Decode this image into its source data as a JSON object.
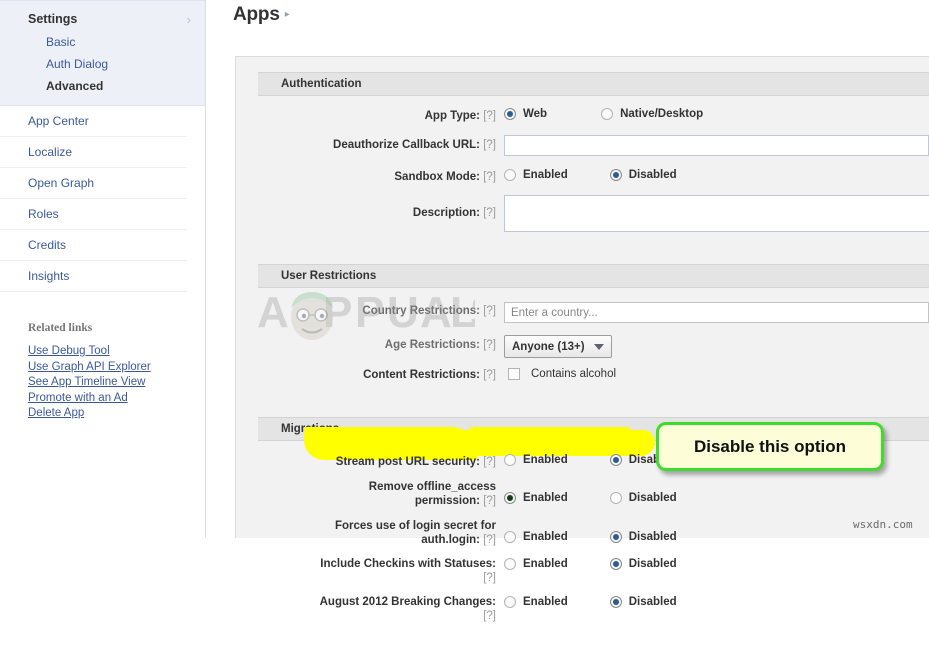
{
  "sidebar": {
    "settings": {
      "title": "Settings",
      "chevron_icon": "chevron-right-icon",
      "items": [
        {
          "label": "Basic",
          "current": false
        },
        {
          "label": "Auth Dialog",
          "current": false
        },
        {
          "label": "Advanced",
          "current": true
        }
      ]
    },
    "nav_items": [
      {
        "label": "App Center"
      },
      {
        "label": "Localize"
      },
      {
        "label": "Open Graph"
      },
      {
        "label": "Roles"
      },
      {
        "label": "Credits"
      },
      {
        "label": "Insights"
      }
    ],
    "related": {
      "title": "Related links",
      "links": [
        {
          "label": "Use Debug Tool"
        },
        {
          "label": "Use Graph API Explorer"
        },
        {
          "label": "See App Timeline View"
        },
        {
          "label": "Promote with an Ad"
        },
        {
          "label": "Delete App"
        }
      ]
    }
  },
  "header": {
    "title": "Apps",
    "breadcrumb_arrow": "▸"
  },
  "sections": {
    "authentication": {
      "heading": "Authentication",
      "app_type": {
        "label": "App Type:",
        "help": "[?]",
        "options": [
          {
            "label": "Web",
            "selected": true
          },
          {
            "label": "Native/Desktop",
            "selected": false
          }
        ]
      },
      "deauthorize_url": {
        "label": "Deauthorize Callback URL:",
        "help": "[?]",
        "value": "",
        "placeholder": ""
      },
      "sandbox_mode": {
        "label": "Sandbox Mode:",
        "help": "[?]",
        "options": [
          {
            "label": "Enabled",
            "selected": false
          },
          {
            "label": "Disabled",
            "selected": true
          }
        ]
      },
      "description": {
        "label": "Description:",
        "help": "[?]",
        "value": "",
        "placeholder": ""
      }
    },
    "user_restrictions": {
      "heading": "User Restrictions",
      "country": {
        "label": "Country Restrictions:",
        "help": "[?]",
        "value": "",
        "placeholder": "Enter a country..."
      },
      "age": {
        "label": "Age Restrictions:",
        "help": "[?]",
        "selected": "Anyone (13+)",
        "caret_icon": "chevron-down-icon"
      },
      "content": {
        "label": "Content Restrictions:",
        "help": "[?]",
        "checkbox_label": "Contains alcohol",
        "checked": false
      }
    },
    "migrations": {
      "heading": "Migrations",
      "rows": [
        {
          "label": "Stream post URL security:",
          "help": "[?]",
          "enabled_label": "Enabled",
          "disabled_label": "Disabled",
          "selected": "Disabled",
          "highlighted": false
        },
        {
          "label_line1": "Remove offline_access",
          "label_line2": "permission:",
          "help": "[?]",
          "enabled_label": "Enabled",
          "disabled_label": "Disabled",
          "selected": "Enabled",
          "highlighted": true
        },
        {
          "label_line1": "Forces use of login secret for",
          "label_line2": "auth.login:",
          "help": "[?]",
          "enabled_label": "Enabled",
          "disabled_label": "Disabled",
          "selected": "Disabled",
          "highlighted": false
        },
        {
          "label_line1": "Include Checkins with Statuses:",
          "label_line2": "[?]",
          "enabled_label": "Enabled",
          "disabled_label": "Disabled",
          "selected": "Disabled",
          "highlighted": false
        },
        {
          "label_line1": "August 2012 Breaking Changes:",
          "label_line2": "[?]",
          "enabled_label": "Enabled",
          "disabled_label": "Disabled",
          "selected": "Disabled",
          "highlighted": false
        }
      ]
    }
  },
  "annotation": {
    "callout_text": "Disable this option",
    "border_color": "#3ddc2e",
    "fill_color": "#fdfdd8",
    "highlight_color": "#ffff00"
  },
  "watermarks": {
    "logo_text": "APPUALS",
    "corner_text": "wsxdn.com"
  }
}
